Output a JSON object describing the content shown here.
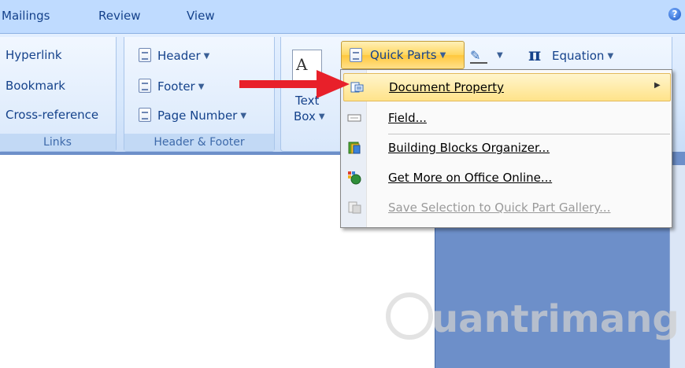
{
  "tabs": [
    {
      "label": "Mailings"
    },
    {
      "label": "Review"
    },
    {
      "label": "View"
    }
  ],
  "help_label": "?",
  "groups": {
    "links": {
      "label": "Links",
      "items": [
        {
          "label": "Hyperlink"
        },
        {
          "label": "Bookmark"
        },
        {
          "label": "Cross-reference"
        }
      ]
    },
    "header_footer": {
      "label": "Header & Footer",
      "items": [
        {
          "label": "Header"
        },
        {
          "label": "Footer"
        },
        {
          "label": "Page Number"
        }
      ]
    },
    "text": {
      "text_box_line1": "Text",
      "text_box_line2": "Box",
      "quick_parts": "Quick Parts",
      "equation": "Equation",
      "pi_symbol": "π"
    }
  },
  "menu": {
    "items": [
      {
        "label": "Document Property",
        "enabled": true,
        "submenu": true
      },
      {
        "label": "Field...",
        "enabled": true
      },
      {
        "label": "Building Blocks Organizer...",
        "enabled": true
      },
      {
        "label": "Get More on Office Online...",
        "enabled": true
      },
      {
        "label": "Save Selection to Quick Part Gallery...",
        "enabled": false
      }
    ]
  },
  "watermark": "uantrimang",
  "colors": {
    "accent_highlight": "#ffe38a",
    "ribbon_text": "#15428b",
    "arrow": "#e8202a"
  }
}
